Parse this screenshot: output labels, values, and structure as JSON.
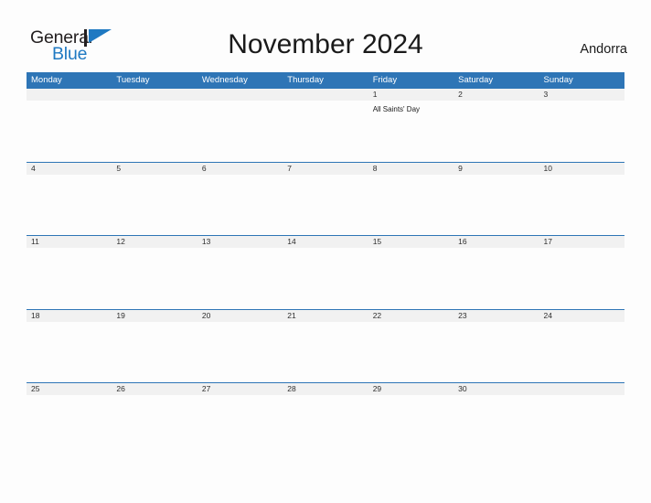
{
  "brand": {
    "name_part1": "General",
    "name_part2": "Blue",
    "flag_color": "#1f79c2",
    "pole_color": "#231f20"
  },
  "header": {
    "title": "November 2024",
    "country": "Andorra"
  },
  "colors": {
    "header_blue": "#2e75b6",
    "row_divider_blue": "#2e75b6",
    "daynum_strip_gray": "#f1f1f1",
    "page_background": "#fdfdfd",
    "text_dark": "#1a1a1a"
  },
  "calendar": {
    "weekdays": [
      "Monday",
      "Tuesday",
      "Wednesday",
      "Thursday",
      "Friday",
      "Saturday",
      "Sunday"
    ],
    "weeks": [
      {
        "days": [
          {
            "num": "",
            "event": ""
          },
          {
            "num": "",
            "event": ""
          },
          {
            "num": "",
            "event": ""
          },
          {
            "num": "",
            "event": ""
          },
          {
            "num": "1",
            "event": "All Saints' Day"
          },
          {
            "num": "2",
            "event": ""
          },
          {
            "num": "3",
            "event": ""
          }
        ]
      },
      {
        "days": [
          {
            "num": "4",
            "event": ""
          },
          {
            "num": "5",
            "event": ""
          },
          {
            "num": "6",
            "event": ""
          },
          {
            "num": "7",
            "event": ""
          },
          {
            "num": "8",
            "event": ""
          },
          {
            "num": "9",
            "event": ""
          },
          {
            "num": "10",
            "event": ""
          }
        ]
      },
      {
        "days": [
          {
            "num": "11",
            "event": ""
          },
          {
            "num": "12",
            "event": ""
          },
          {
            "num": "13",
            "event": ""
          },
          {
            "num": "14",
            "event": ""
          },
          {
            "num": "15",
            "event": ""
          },
          {
            "num": "16",
            "event": ""
          },
          {
            "num": "17",
            "event": ""
          }
        ]
      },
      {
        "days": [
          {
            "num": "18",
            "event": ""
          },
          {
            "num": "19",
            "event": ""
          },
          {
            "num": "20",
            "event": ""
          },
          {
            "num": "21",
            "event": ""
          },
          {
            "num": "22",
            "event": ""
          },
          {
            "num": "23",
            "event": ""
          },
          {
            "num": "24",
            "event": ""
          }
        ]
      },
      {
        "days": [
          {
            "num": "25",
            "event": ""
          },
          {
            "num": "26",
            "event": ""
          },
          {
            "num": "27",
            "event": ""
          },
          {
            "num": "28",
            "event": ""
          },
          {
            "num": "29",
            "event": ""
          },
          {
            "num": "30",
            "event": ""
          },
          {
            "num": "",
            "event": ""
          }
        ]
      }
    ]
  }
}
